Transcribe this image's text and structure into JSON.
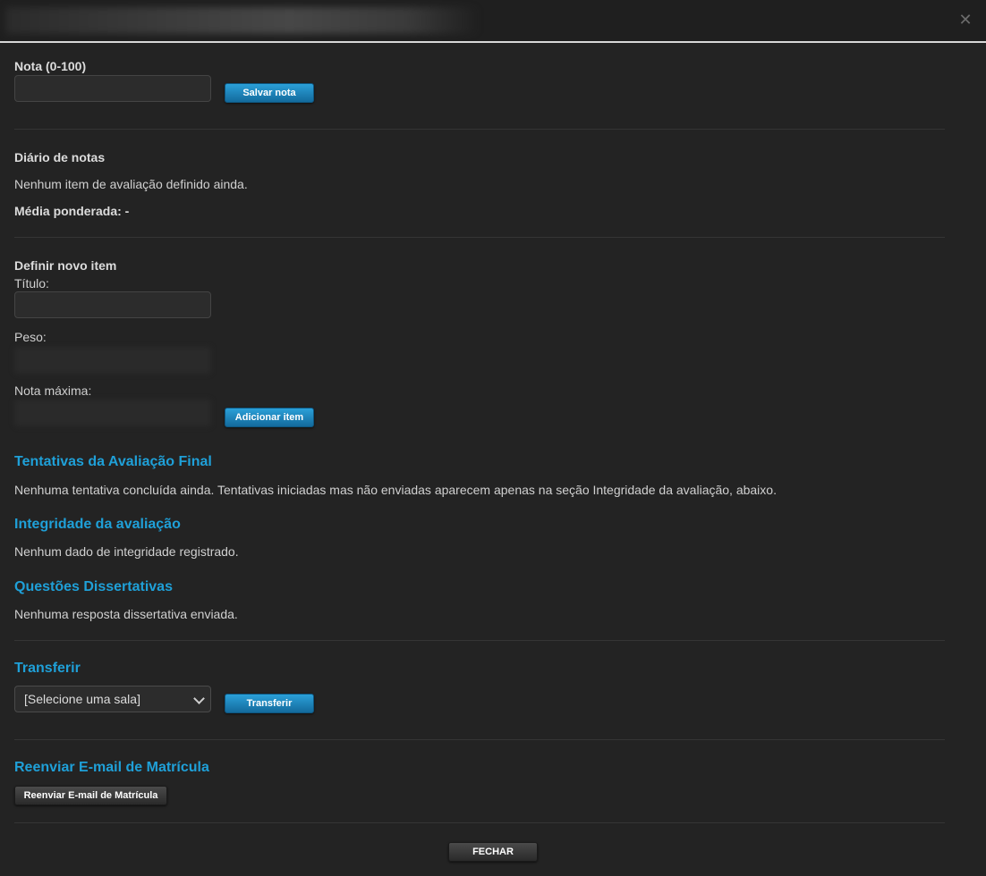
{
  "grade": {
    "label": "Nota (0-100)",
    "value": "",
    "save_button": "Salvar nota"
  },
  "gradebook": {
    "title": "Diário de notas",
    "empty_text": "Nenhum item de avaliação definido ainda.",
    "weighted_average": "Média ponderada: -"
  },
  "new_item": {
    "title": "Definir novo item",
    "title_label": "Título:",
    "title_value": "",
    "weight_label": "Peso:",
    "max_grade_label": "Nota máxima:",
    "add_button": "Adicionar item"
  },
  "final_attempts": {
    "title": "Tentativas da Avaliação Final",
    "text": "Nenhuma tentativa concluída ainda. Tentativas iniciadas mas não enviadas aparecem apenas na seção Integridade da avaliação, abaixo."
  },
  "integrity": {
    "title": "Integridade da avaliação",
    "text": "Nenhum dado de integridade registrado."
  },
  "essays": {
    "title": "Questões Dissertativas",
    "text": "Nenhuma resposta dissertativa enviada."
  },
  "transfer": {
    "title": "Transferir",
    "select_value": "[Selecione uma sala]",
    "button": "Transferir"
  },
  "resend": {
    "title": "Reenviar E-mail de Matrícula",
    "button": "Reenviar E-mail de Matrícula"
  },
  "footer": {
    "close_button": "FECHAR"
  },
  "icons": {
    "close": "close-icon",
    "dropdown": "chevron-down-icon"
  },
  "colors": {
    "accent": "#1fa0d8",
    "background": "#232323",
    "button_blue": "#1a86c0"
  }
}
